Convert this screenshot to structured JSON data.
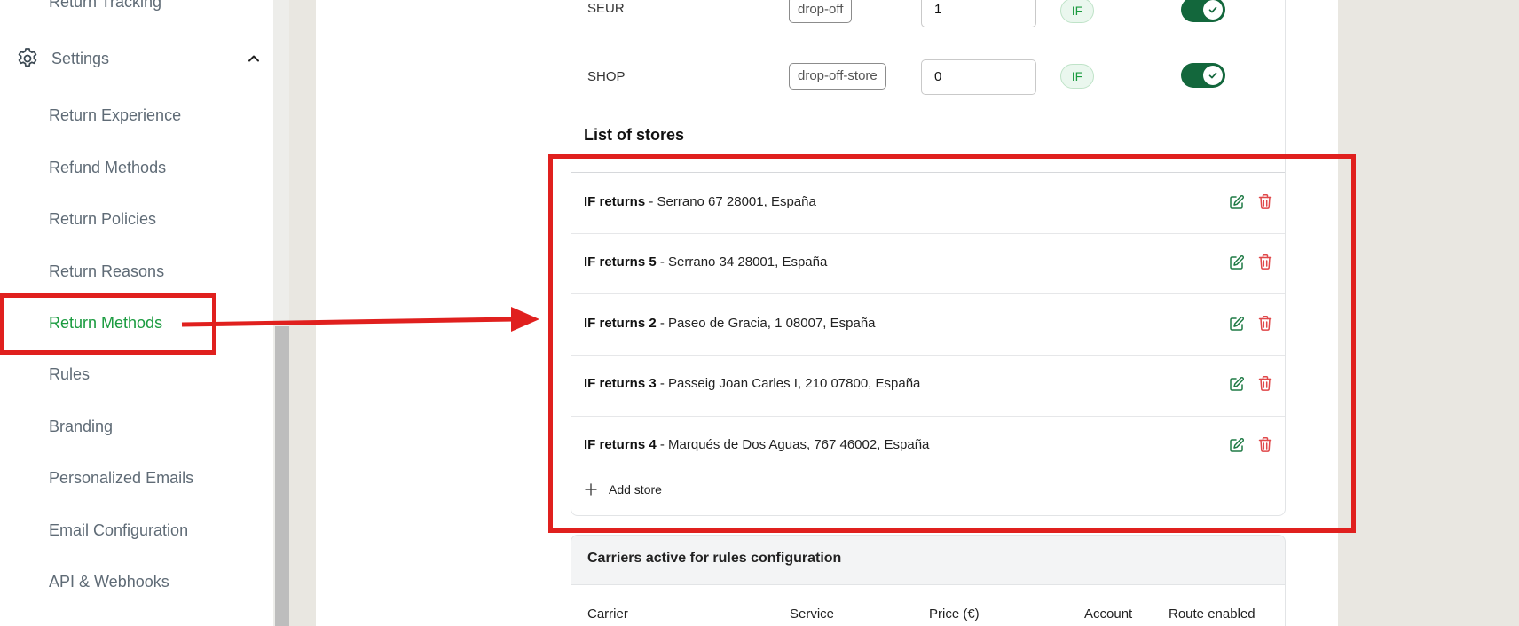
{
  "sidebar": {
    "return_tracking": "Return Tracking",
    "settings_label": "Settings",
    "items": [
      {
        "label": "Return Experience"
      },
      {
        "label": "Refund Methods"
      },
      {
        "label": "Return Policies"
      },
      {
        "label": "Return Reasons"
      },
      {
        "label": "Return Methods"
      },
      {
        "label": "Rules"
      },
      {
        "label": "Branding"
      },
      {
        "label": "Personalized Emails"
      },
      {
        "label": "Email Configuration"
      },
      {
        "label": "API & Webhooks"
      }
    ],
    "active_item": "Return Methods"
  },
  "carrier_rows": [
    {
      "name": "SEUR",
      "service": "drop-off",
      "value": "1",
      "account": "IF",
      "enabled": true
    },
    {
      "name": "SHOP",
      "service": "drop-off-store",
      "value": "0",
      "account": "IF",
      "enabled": true
    }
  ],
  "stores": {
    "title": "List of stores",
    "items": [
      {
        "name": "IF returns",
        "address": " - Serrano 67 28001, España"
      },
      {
        "name": "IF returns 5",
        "address": " - Serrano 34 28001, España"
      },
      {
        "name": "IF returns 2",
        "address": " - Paseo de Gracia, 1 08007, España"
      },
      {
        "name": "IF returns 3",
        "address": " - Passeig Joan Carles I, 210 07800, España"
      },
      {
        "name": "IF returns 4",
        "address": " - Marqués de Dos Aguas, 767 46002, España"
      }
    ],
    "add_label": "Add store"
  },
  "carriers_config": {
    "title": "Carriers active for rules configuration",
    "columns": [
      "Carrier",
      "Service",
      "Price (€)",
      "Account",
      "Route enabled"
    ]
  },
  "colors": {
    "accent_green": "#1a9b3f",
    "toggle_green": "#13673c",
    "annotation_red": "#e0201e",
    "delete_red": "#e0484a"
  }
}
